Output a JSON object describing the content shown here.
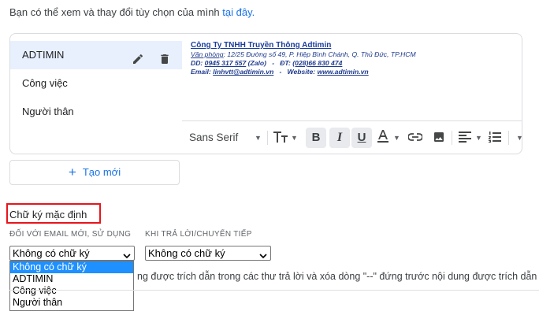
{
  "intro": {
    "text": "Bạn có thể xem và thay đổi tùy chọn của mình ",
    "link": "tại đây."
  },
  "signatures": {
    "items": [
      {
        "label": "ADTIMIN"
      },
      {
        "label": "Công việc"
      },
      {
        "label": "Người thân"
      }
    ]
  },
  "signature_body": {
    "company_prefix": "Công Ty TNHH ",
    "company_name": "Truyền Thông Adtimin",
    "address_label": "Văn phòng",
    "address_text": ": 12/25 Đường số 49, P. Hiệp Bình Chánh, Q. Thủ Đức, TP.HCM",
    "dd_label": "DD: ",
    "dd_value": "0945 317 557",
    "dd_suffix": " (Zalo)",
    "dt_label": "   -   ĐT: ",
    "dt_value": "(028)66 830 474",
    "email_label": "Email: ",
    "email_value": "linhvtt@adtimin.vn",
    "web_label": "   -   Website: ",
    "web_value": "www.adtimin.vn"
  },
  "toolbar": {
    "font": "Sans Serif",
    "bold": "B",
    "italic": "I",
    "underline": "U"
  },
  "create_button": {
    "plus": "+",
    "label": "Tạo mới"
  },
  "default_section": {
    "title": "Chữ ký mặc định",
    "new_email_label": "ĐỐI VỚI EMAIL MỚI, SỬ DỤNG",
    "reply_label": "KHI TRẢ LỜI/CHUYỂN TIẾP",
    "new_email_value": "Không có chữ ký",
    "reply_value": "Không có chữ ký",
    "options": [
      "Không có chữ ký",
      "ADTIMIN",
      "Công việc",
      "Người thân"
    ],
    "note": "ng được trích dẫn trong các thư trả lời và xóa dòng \"--\" đứng trước nội dung được trích dẫn"
  },
  "colors": {
    "accent": "#1a73e8",
    "highlight": "#1e90ff",
    "red_box": "#e8141c",
    "active_row": "#e8f0fe"
  }
}
